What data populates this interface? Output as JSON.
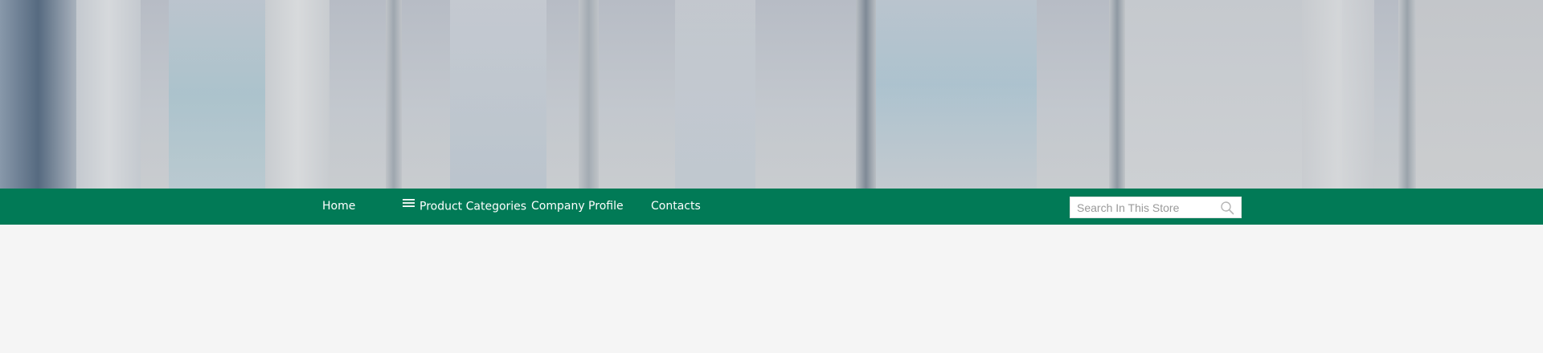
{
  "nav": {
    "items": [
      {
        "label": "Home"
      },
      {
        "label": "Product Categories",
        "icon": "menu-icon"
      },
      {
        "label": "Company Profile"
      },
      {
        "label": "Contacts"
      }
    ]
  },
  "search": {
    "placeholder": "Search In This Store",
    "value": "",
    "icon": "search-icon"
  },
  "colors": {
    "nav_background": "#017a56",
    "nav_text": "#ffffff",
    "page_background": "#f5f5f5"
  }
}
